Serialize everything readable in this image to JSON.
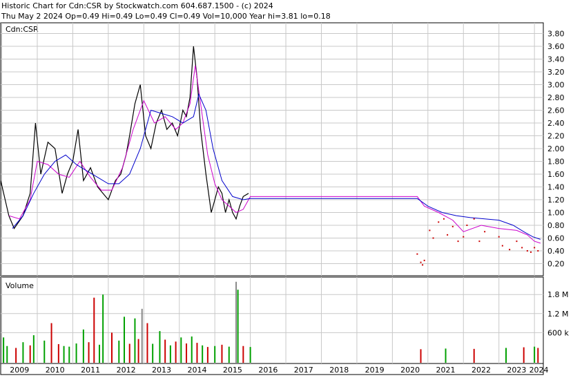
{
  "header": {
    "line1": "Historic Chart for Cdn:CSR by Stockwatch.com 604.687.1500 - (c) 2024",
    "line2": "Thu May  2 2024  Op=0.49  Hi=0.49  Lo=0.49  Cl=0.49  Vol=10,000  Year hi=3.81  lo=0.18"
  },
  "chart_data": [
    {
      "type": "line",
      "title": "Cdn:CSR",
      "ylim": [
        0.0,
        3.9
      ],
      "y_ticks": [
        "3.80",
        "3.60",
        "3.40",
        "3.20",
        "3.00",
        "2.80",
        "2.60",
        "2.40",
        "2.20",
        "2.00",
        "1.80",
        "1.60",
        "1.40",
        "1.20",
        "1.00",
        "0.80",
        "0.60",
        "0.40",
        "0.20"
      ],
      "x_ticks": [
        "2009",
        "2010",
        "2011",
        "2012",
        "2013",
        "2014",
        "2015",
        "2016",
        "2017",
        "2018",
        "2019",
        "2020",
        "2021",
        "2022",
        "2023",
        "2024"
      ],
      "grid": true,
      "colors": {
        "price": "#000000",
        "ma_short": "#cc00cc",
        "ma_long": "#0000cc",
        "scatter": "#cc0000"
      },
      "series": [
        {
          "key": "price",
          "x": [
            2008.97,
            2009.2,
            2009.35,
            2009.6,
            2009.8,
            2009.95,
            2010.1,
            2010.3,
            2010.5,
            2010.7,
            2010.85,
            2011.0,
            2011.15,
            2011.3,
            2011.5,
            2011.7,
            2011.85,
            2012.0,
            2012.2,
            2012.35,
            2012.5,
            2012.6,
            2012.75,
            2012.9,
            2013.05,
            2013.2,
            2013.35,
            2013.5,
            2013.65,
            2013.8,
            2013.95,
            2014.1,
            2014.2,
            2014.3,
            2014.4,
            2014.5,
            2014.6,
            2014.75,
            2014.9,
            2015.0,
            2015.1,
            2015.2,
            2015.3,
            2015.4,
            2015.5,
            2015.6,
            2015.7,
            2015.8,
            2015.95
          ],
          "y": [
            1.5,
            0.95,
            0.75,
            0.95,
            1.3,
            2.4,
            1.6,
            2.1,
            2.0,
            1.3,
            1.6,
            1.8,
            2.3,
            1.5,
            1.7,
            1.4,
            1.3,
            1.2,
            1.5,
            1.6,
            1.9,
            2.2,
            2.7,
            3.0,
            2.2,
            2.0,
            2.4,
            2.6,
            2.3,
            2.4,
            2.2,
            2.6,
            2.5,
            2.8,
            3.6,
            3.1,
            2.3,
            1.6,
            1.0,
            1.2,
            1.4,
            1.3,
            1.0,
            1.2,
            1.0,
            0.9,
            1.1,
            1.25,
            1.3
          ]
        },
        {
          "key": "ma_short",
          "x": [
            2009.2,
            2009.5,
            2009.8,
            2010.0,
            2010.3,
            2010.6,
            2010.9,
            2011.2,
            2011.5,
            2011.8,
            2012.1,
            2012.4,
            2012.7,
            2013.0,
            2013.3,
            2013.6,
            2013.9,
            2014.1,
            2014.3,
            2014.45,
            2014.6,
            2014.8,
            2015.0,
            2015.2,
            2015.4,
            2015.6,
            2015.8,
            2016.0,
            2020.7,
            2020.9,
            2021.3,
            2021.7,
            2022.0,
            2022.5,
            2023.0,
            2023.5,
            2023.8,
            2024.0,
            2024.17
          ],
          "y": [
            0.95,
            0.9,
            1.2,
            1.8,
            1.75,
            1.6,
            1.55,
            1.8,
            1.55,
            1.35,
            1.35,
            1.7,
            2.3,
            2.75,
            2.4,
            2.5,
            2.3,
            2.4,
            2.7,
            3.3,
            2.7,
            1.9,
            1.45,
            1.2,
            1.1,
            1.0,
            1.05,
            1.25,
            1.25,
            1.1,
            1.0,
            0.88,
            0.7,
            0.8,
            0.75,
            0.72,
            0.65,
            0.55,
            0.52
          ]
        },
        {
          "key": "ma_long",
          "x": [
            2009.3,
            2009.6,
            2009.9,
            2010.2,
            2010.5,
            2010.8,
            2011.1,
            2011.4,
            2011.7,
            2012.0,
            2012.3,
            2012.6,
            2012.9,
            2013.2,
            2013.5,
            2013.8,
            2014.1,
            2014.4,
            2014.55,
            2014.75,
            2014.95,
            2015.2,
            2015.5,
            2015.8,
            2016.0,
            2020.7,
            2021.0,
            2021.4,
            2021.8,
            2022.2,
            2022.6,
            2023.0,
            2023.4,
            2023.7,
            2023.95,
            2024.17
          ],
          "y": [
            0.75,
            0.95,
            1.3,
            1.6,
            1.8,
            1.9,
            1.75,
            1.65,
            1.55,
            1.45,
            1.45,
            1.6,
            2.0,
            2.6,
            2.55,
            2.5,
            2.4,
            2.5,
            2.85,
            2.6,
            2.0,
            1.5,
            1.25,
            1.2,
            1.22,
            1.22,
            1.1,
            1.0,
            0.95,
            0.92,
            0.9,
            0.88,
            0.8,
            0.7,
            0.62,
            0.58
          ]
        },
        {
          "key": "scatter",
          "x": [
            2020.7,
            2020.8,
            2020.85,
            2020.9,
            2021.05,
            2021.15,
            2021.3,
            2021.45,
            2021.55,
            2021.7,
            2021.85,
            2022.0,
            2022.1,
            2022.3,
            2022.45,
            2022.6,
            2023.0,
            2023.1,
            2023.3,
            2023.5,
            2023.65,
            2023.8,
            2023.9,
            2024.0,
            2024.1
          ],
          "y": [
            0.35,
            0.22,
            0.18,
            0.25,
            0.72,
            0.6,
            0.85,
            0.9,
            0.65,
            0.78,
            0.55,
            0.62,
            0.8,
            0.9,
            0.55,
            0.7,
            0.62,
            0.48,
            0.42,
            0.55,
            0.45,
            0.4,
            0.38,
            0.45,
            0.4
          ]
        }
      ]
    },
    {
      "type": "bar",
      "title": "Volume",
      "ylim": [
        0,
        2200000
      ],
      "y_ticks": [
        "1.8 M",
        "1.2 M",
        "600 k"
      ],
      "y_tick_values": [
        1800000,
        1200000,
        600000
      ],
      "colors": {
        "up": "#00a000",
        "down": "#cc0000",
        "neutral": "#888888"
      },
      "x": [
        2009.05,
        2009.15,
        2009.4,
        2009.6,
        2009.8,
        2009.9,
        2010.2,
        2010.4,
        2010.6,
        2010.75,
        2010.9,
        2011.1,
        2011.3,
        2011.45,
        2011.6,
        2011.75,
        2011.85,
        2012.1,
        2012.3,
        2012.45,
        2012.6,
        2012.75,
        2012.85,
        2012.95,
        2013.1,
        2013.25,
        2013.45,
        2013.6,
        2013.75,
        2013.9,
        2014.05,
        2014.2,
        2014.35,
        2014.5,
        2014.65,
        2014.8,
        2015.0,
        2015.2,
        2015.4,
        2015.6,
        2015.65,
        2015.8,
        2016.0,
        2020.8,
        2021.5,
        2022.3,
        2023.2,
        2023.7,
        2024.0,
        2024.1
      ],
      "values": [
        450000,
        180000,
        120000,
        300000,
        200000,
        520000,
        350000,
        900000,
        240000,
        180000,
        160000,
        260000,
        700000,
        300000,
        1700000,
        220000,
        1800000,
        600000,
        350000,
        1100000,
        250000,
        1050000,
        400000,
        1350000,
        900000,
        250000,
        650000,
        380000,
        200000,
        320000,
        450000,
        260000,
        480000,
        280000,
        200000,
        150000,
        180000,
        220000,
        160000,
        2200000,
        1950000,
        180000,
        150000,
        80000,
        100000,
        90000,
        120000,
        140000,
        160000,
        120000
      ],
      "direction": [
        "up",
        "up",
        "down",
        "up",
        "down",
        "up",
        "up",
        "down",
        "down",
        "up",
        "up",
        "up",
        "up",
        "down",
        "down",
        "up",
        "up",
        "down",
        "up",
        "up",
        "down",
        "up",
        "down",
        "neutral",
        "down",
        "up",
        "up",
        "down",
        "up",
        "down",
        "up",
        "down",
        "up",
        "down",
        "up",
        "down",
        "up",
        "down",
        "up",
        "neutral",
        "up",
        "down",
        "up",
        "down",
        "up",
        "down",
        "up",
        "down",
        "up",
        "down"
      ]
    }
  ]
}
